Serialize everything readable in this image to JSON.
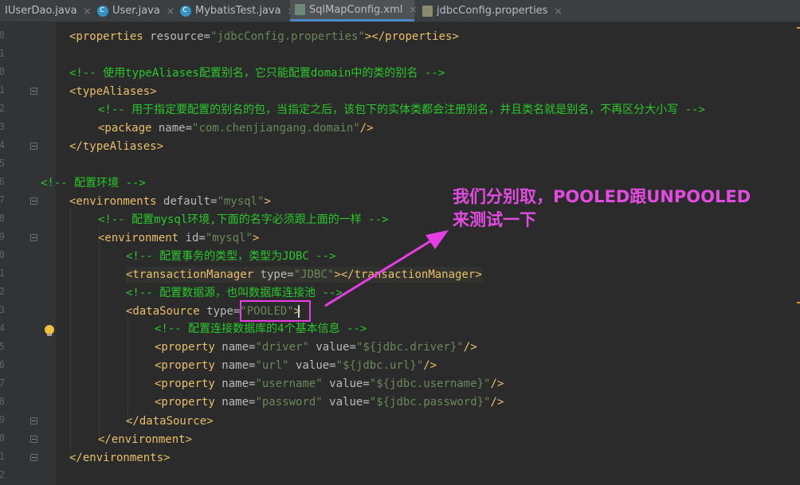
{
  "tabs": [
    {
      "label": "IUserDao.java",
      "icon": "java-interface-icon",
      "close": "×"
    },
    {
      "label": "User.java",
      "icon": "java-class-icon",
      "close": "×"
    },
    {
      "label": "MybatisTest.java",
      "icon": "java-class-icon",
      "close": "×"
    },
    {
      "label": "SqlMapConfig.xml",
      "icon": "xml-file-icon",
      "close": "×",
      "active": true
    },
    {
      "label": "jdbcConfig.properties",
      "icon": "properties-file-icon",
      "close": "×"
    }
  ],
  "gutter": {
    "line_numbers": [
      "0",
      "1",
      "0",
      "1",
      "2",
      "3",
      "4",
      "5",
      "6",
      "7",
      "8",
      "9",
      "0",
      "1",
      "2",
      "3",
      "4",
      "5",
      "6",
      "7",
      "8",
      "9",
      "0",
      "1",
      "2",
      "5"
    ]
  },
  "code": {
    "l1": {
      "t1": "<properties ",
      "a1": "resource=",
      "v1": "\"jdbcConfig.properties\"",
      "t2": "></properties>"
    },
    "l3": {
      "c": "<!-- 使用typeAliases配置别名，它只能配置domain中的类的别名 -->"
    },
    "l4": {
      "t": "<typeAliases>"
    },
    "l5": {
      "c": "<!-- 用于指定要配置的别名的包，当指定之后，该包下的实体类都会注册别名，并且类名就是别名，不再区分大小写 -->"
    },
    "l6": {
      "t1": "<package ",
      "a1": "name=",
      "v1": "\"com.chenjiangang.domain\"",
      "t2": "/>"
    },
    "l7": {
      "t": "</typeAliases>"
    },
    "l9": {
      "c": "<!-- 配置环境 -->"
    },
    "l10": {
      "t1": "<environments ",
      "a1": "default=",
      "v1": "\"mysql\"",
      "t2": ">"
    },
    "l11": {
      "c": "<!-- 配置mysql环境,下面的名字必须跟上面的一样 -->"
    },
    "l12": {
      "t1": "<environment ",
      "a1": "id=",
      "v1": "\"mysql\"",
      "t2": ">"
    },
    "l13": {
      "c": "<!-- 配置事务的类型，类型为JDBC -->"
    },
    "l14": {
      "t1": "<transactionManager ",
      "a1": "type=",
      "v1": "\"JDBC\"",
      "t2": "></transactionManager>"
    },
    "l15": {
      "c": "<!-- 配置数据源，也叫数据库连接池 -->"
    },
    "l16": {
      "t1": "<dataSource ",
      "a1": "type=",
      "v1": "\"POOLED\"",
      "t2": ">"
    },
    "l17": {
      "c": "<!-- 配置连接数据库的4个基本信息 -->"
    },
    "l18": {
      "t1": "<property ",
      "a1": "name=",
      "v1": "\"driver\"",
      "a2": " value=",
      "v2": "\"${jdbc.driver}\"",
      "t2": "/>"
    },
    "l19": {
      "t1": "<property ",
      "a1": "name=",
      "v1": "\"url\"",
      "a2": " value=",
      "v2": "\"${jdbc.url}\"",
      "t2": "/>"
    },
    "l20": {
      "t1": "<property ",
      "a1": "name=",
      "v1": "\"username\"",
      "a2": " value=",
      "v2": "\"${jdbc.username}\"",
      "t2": "/>"
    },
    "l21": {
      "t1": "<property ",
      "a1": "name=",
      "v1": "\"password\"",
      "a2": " value=",
      "v2": "\"${jdbc.password}\"",
      "t2": "/>"
    },
    "l22": {
      "t": "</dataSource>"
    },
    "l23": {
      "t": "</environment>"
    },
    "l24": {
      "t": "</environments>"
    }
  },
  "annotation": {
    "text": "我们分别取，POOLED跟UNPOOLED\n来测试一下",
    "color": "#e24be0"
  },
  "colors": {
    "tag": "#e8bf6a",
    "attr": "#bababa",
    "value": "#6a8759",
    "comment": "#29c72a",
    "background": "#2b2b2b"
  }
}
